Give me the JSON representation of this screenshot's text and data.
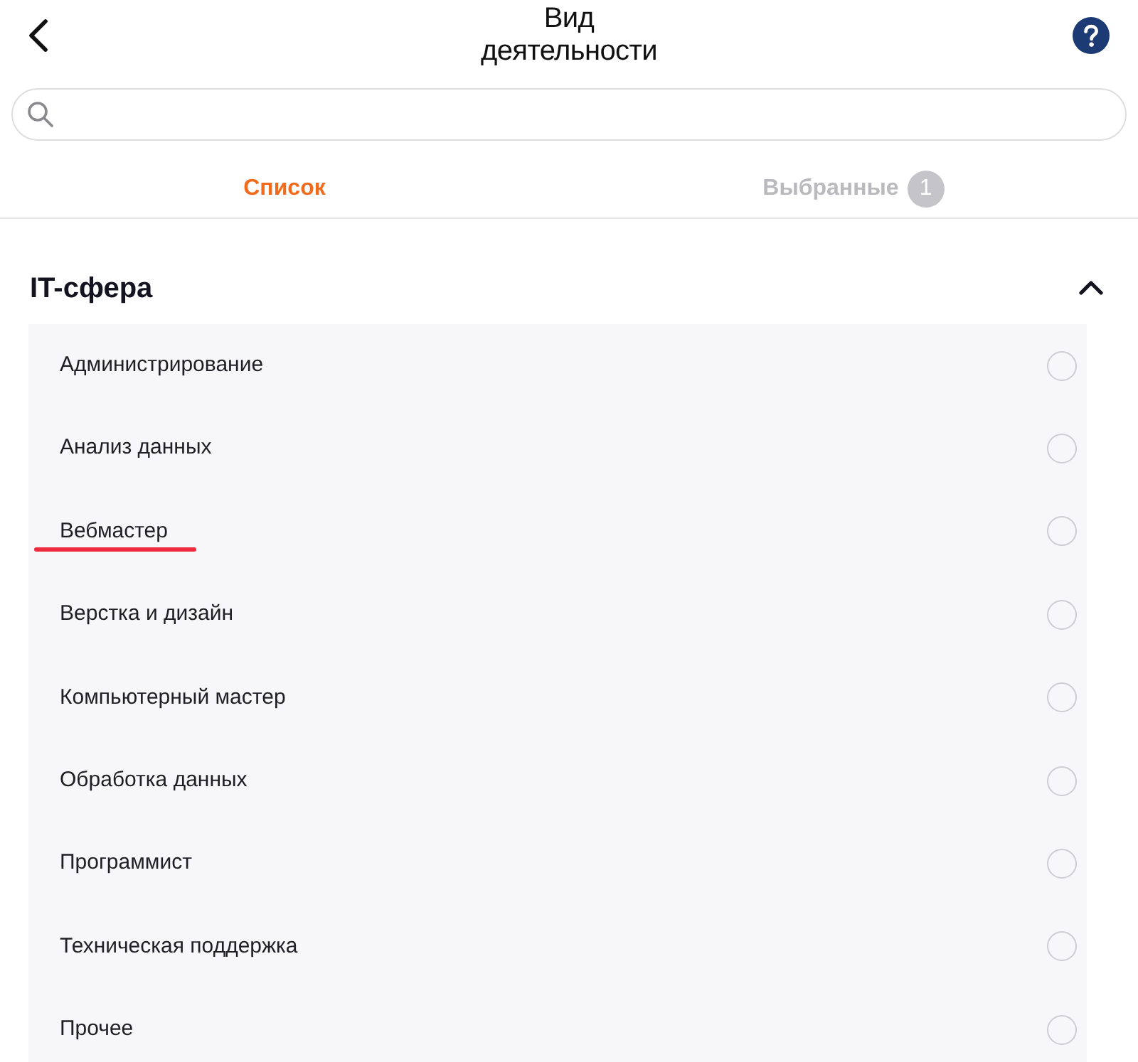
{
  "header": {
    "title": "Вид деятельности"
  },
  "tabs": [
    {
      "label": "Список",
      "selected": true
    },
    {
      "label": "Выбранные",
      "selected": false,
      "badge": "1"
    }
  ],
  "section": {
    "title": "IT-сфера",
    "expanded": true,
    "items": [
      {
        "label": "Администрирование",
        "selected": false,
        "underlined": false
      },
      {
        "label": "Анализ данных",
        "selected": false,
        "underlined": false
      },
      {
        "label": "Вебмастер",
        "selected": false,
        "underlined": true
      },
      {
        "label": "Верстка и дизайн",
        "selected": false,
        "underlined": false
      },
      {
        "label": "Компьютерный мастер",
        "selected": false,
        "underlined": false
      },
      {
        "label": "Обработка данных",
        "selected": false,
        "underlined": false
      },
      {
        "label": "Программист",
        "selected": false,
        "underlined": false
      },
      {
        "label": "Техническая поддержка",
        "selected": false,
        "underlined": false
      },
      {
        "label": "Прочее",
        "selected": false,
        "underlined": false
      }
    ]
  }
}
